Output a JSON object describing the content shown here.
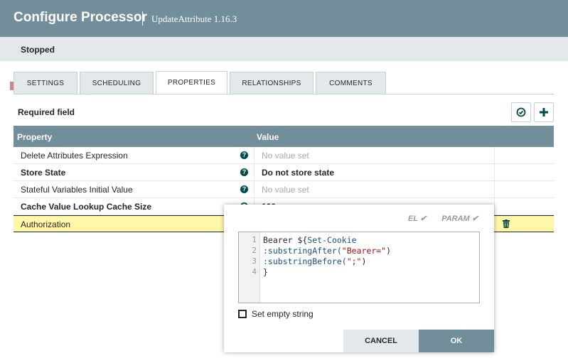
{
  "header": {
    "title": "Configure Processor",
    "subtitle": "UpdateAttribute 1.16.3"
  },
  "status": {
    "label": "Stopped",
    "color": "#d18686"
  },
  "tabs": [
    {
      "label": "SETTINGS"
    },
    {
      "label": "SCHEDULING"
    },
    {
      "label": "PROPERTIES"
    },
    {
      "label": "RELATIONSHIPS"
    },
    {
      "label": "COMMENTS"
    }
  ],
  "required_field": "Required field",
  "table": {
    "headers": {
      "property": "Property",
      "value": "Value"
    },
    "rows": [
      {
        "property": "Delete Attributes Expression",
        "value": "No value set"
      },
      {
        "property": "Store State",
        "value": "Do not store state"
      },
      {
        "property": "Stateful Variables Initial Value",
        "value": "No value set"
      },
      {
        "property": "Cache Value Lookup Cache Size",
        "value": "100"
      },
      {
        "property": "Authorization",
        "value": ""
      }
    ]
  },
  "editor": {
    "el_label": "EL ✔",
    "param_label": "PARAM ✔",
    "lines": [
      "1",
      "2",
      "3",
      "4"
    ],
    "code": {
      "l1a": "Bearer ",
      "l1b": "${",
      "l1c": "Set-Cookie",
      "l2a": ":substringAfter(",
      "l2b": "\"Bearer=\"",
      "l2c": ")",
      "l3a": ":substringBefore(",
      "l3b": "\";\"",
      "l3c": ")",
      "l4": "}"
    },
    "set_empty_string": "Set empty string",
    "cancel": "CANCEL",
    "ok": "OK"
  }
}
